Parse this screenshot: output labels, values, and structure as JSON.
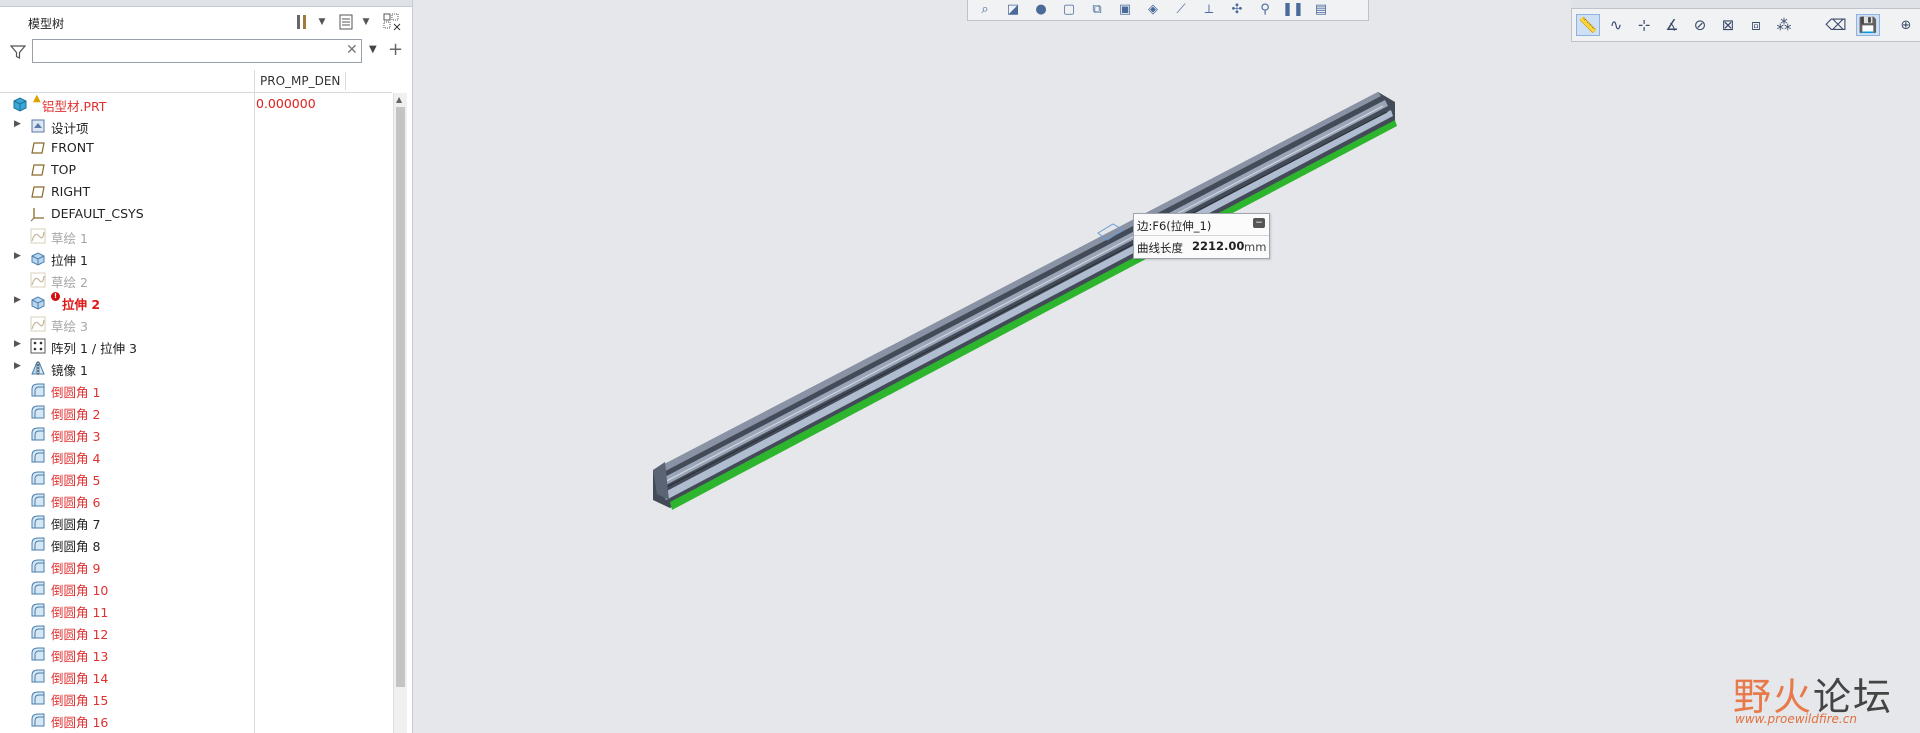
{
  "model_tree": {
    "title": "模型树",
    "search": {
      "value": "",
      "placeholder": ""
    },
    "column_header": "PRO_MP_DEN",
    "root": {
      "label": "铝型材.PRT",
      "value": "0.000000"
    },
    "items": [
      {
        "label": "设计项",
        "style": "dark",
        "icon": "design-items-icon",
        "expandable": true
      },
      {
        "label": "FRONT",
        "style": "dark",
        "icon": "datum-plane-icon",
        "expandable": false
      },
      {
        "label": "TOP",
        "style": "dark",
        "icon": "datum-plane-icon",
        "expandable": false
      },
      {
        "label": "RIGHT",
        "style": "dark",
        "icon": "datum-plane-icon",
        "expandable": false
      },
      {
        "label": "DEFAULT_CSYS",
        "style": "dark",
        "icon": "csys-icon",
        "expandable": false
      },
      {
        "label": "草绘 1",
        "style": "gray",
        "icon": "sketch-icon",
        "expandable": false
      },
      {
        "label": "拉伸 1",
        "style": "dark",
        "icon": "extrude-icon",
        "expandable": true
      },
      {
        "label": "草绘 2",
        "style": "gray",
        "icon": "sketch-icon",
        "expandable": false
      },
      {
        "label": "拉伸 2",
        "style": "bold-red",
        "icon": "extrude-icon",
        "expandable": true
      },
      {
        "label": "草绘 3",
        "style": "gray",
        "icon": "sketch-icon",
        "expandable": false
      },
      {
        "label": "阵列 1 / 拉伸 3",
        "style": "dark",
        "icon": "pattern-icon",
        "expandable": true
      },
      {
        "label": "镜像 1",
        "style": "dark",
        "icon": "mirror-icon",
        "expandable": true
      },
      {
        "label": "倒圆角 1",
        "style": "red",
        "icon": "round-icon",
        "expandable": false
      },
      {
        "label": "倒圆角 2",
        "style": "red",
        "icon": "round-icon",
        "expandable": false
      },
      {
        "label": "倒圆角 3",
        "style": "red",
        "icon": "round-icon",
        "expandable": false
      },
      {
        "label": "倒圆角 4",
        "style": "red",
        "icon": "round-icon",
        "expandable": false
      },
      {
        "label": "倒圆角 5",
        "style": "red",
        "icon": "round-icon",
        "expandable": false
      },
      {
        "label": "倒圆角 6",
        "style": "red",
        "icon": "round-icon",
        "expandable": false
      },
      {
        "label": "倒圆角 7",
        "style": "dark",
        "icon": "round-icon",
        "expandable": false
      },
      {
        "label": "倒圆角 8",
        "style": "dark",
        "icon": "round-icon",
        "expandable": false
      },
      {
        "label": "倒圆角 9",
        "style": "red",
        "icon": "round-icon",
        "expandable": false
      },
      {
        "label": "倒圆角 10",
        "style": "red",
        "icon": "round-icon",
        "expandable": false
      },
      {
        "label": "倒圆角 11",
        "style": "red",
        "icon": "round-icon",
        "expandable": false
      },
      {
        "label": "倒圆角 12",
        "style": "red",
        "icon": "round-icon",
        "expandable": false
      },
      {
        "label": "倒圆角 13",
        "style": "red",
        "icon": "round-icon",
        "expandable": false
      },
      {
        "label": "倒圆角 14",
        "style": "red",
        "icon": "round-icon",
        "expandable": false
      },
      {
        "label": "倒圆角 15",
        "style": "red",
        "icon": "round-icon",
        "expandable": false
      },
      {
        "label": "倒圆角 16",
        "style": "red",
        "icon": "round-icon",
        "expandable": false
      }
    ]
  },
  "measure_tooltip": {
    "title": "边:F6(拉伸_1)",
    "label": "曲线长度",
    "value": "2212.00",
    "unit": "mm"
  },
  "watermark": {
    "text_a": "野火",
    "text_b": "论坛",
    "url": "www.proewildfire.cn"
  },
  "colors": {
    "error_red": "#e03030",
    "suppressed_gray": "#a6a6a6",
    "highlight_green": "#2db52d",
    "model_dark": "#3a4150",
    "viewport_bg": "#e6e7ea"
  }
}
